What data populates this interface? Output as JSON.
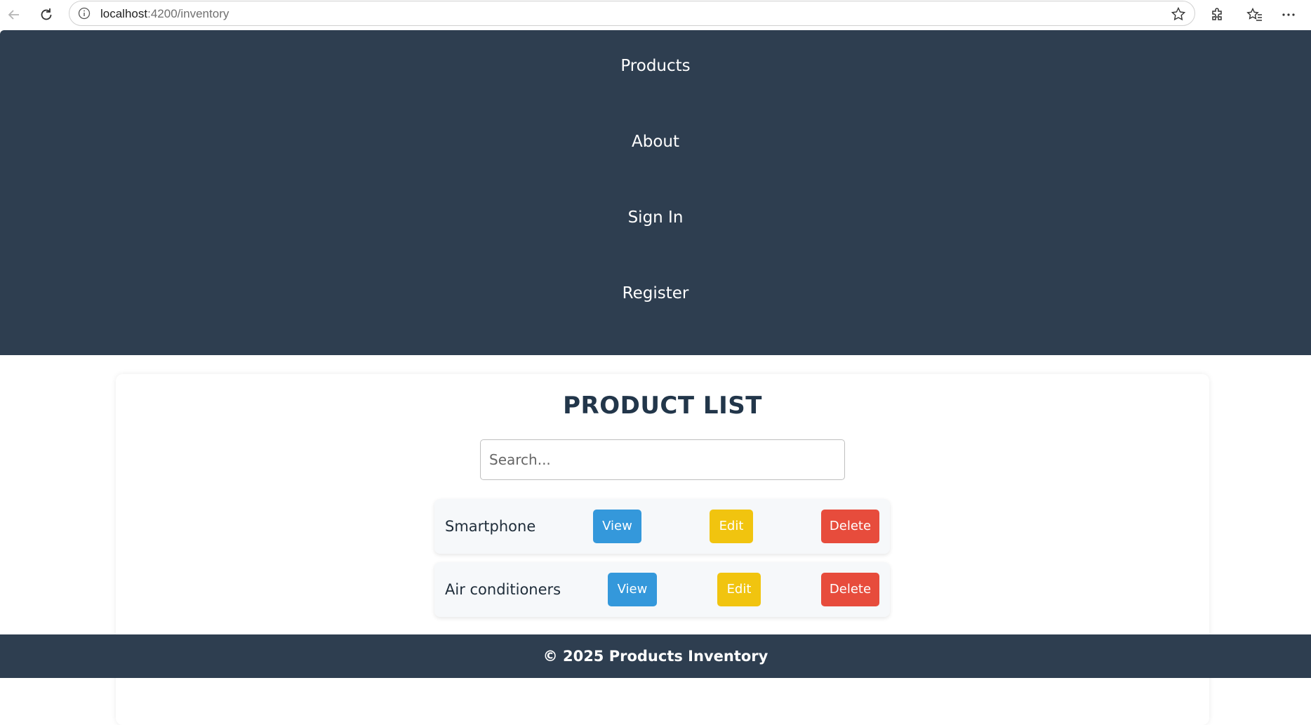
{
  "browser": {
    "url_host": "localhost",
    "url_path": ":4200/inventory"
  },
  "nav": {
    "items": [
      {
        "label": "Products"
      },
      {
        "label": "About"
      },
      {
        "label": "Sign In"
      },
      {
        "label": "Register"
      }
    ]
  },
  "main": {
    "title": "PRODUCT LIST",
    "search_placeholder": "Search...",
    "products": [
      {
        "name": "Smartphone",
        "view_label": "View",
        "edit_label": "Edit",
        "delete_label": "Delete"
      },
      {
        "name": "Air conditioners",
        "view_label": "View",
        "edit_label": "Edit",
        "delete_label": "Delete"
      }
    ]
  },
  "footer": {
    "text": "© 2025 Products Inventory"
  },
  "colors": {
    "nav_bg": "#2e3e50",
    "view": "#3498db",
    "edit": "#f1c40f",
    "delete": "#e74c3c"
  },
  "icons": {
    "back": "back-arrow-icon",
    "reload": "reload-icon",
    "info": "info-icon",
    "favorite": "star-icon",
    "extensions": "puzzle-icon",
    "favorites": "favorites-icon",
    "more": "more-icon"
  }
}
